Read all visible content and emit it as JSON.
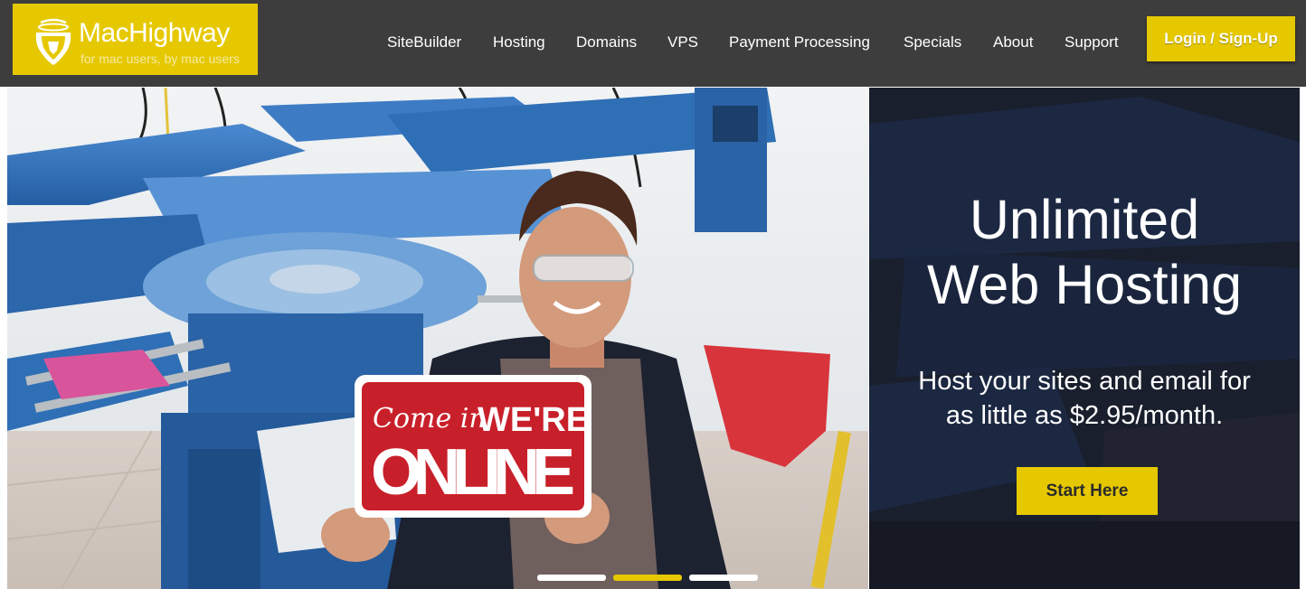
{
  "header": {
    "logo": {
      "name": "MacHighway",
      "tagline": "for mac users, by mac users"
    },
    "nav": [
      {
        "label": "SiteBuilder"
      },
      {
        "label": "Hosting"
      },
      {
        "label": "Domains"
      },
      {
        "label": "VPS"
      },
      {
        "label": "Payment Processing"
      },
      {
        "label": "Specials"
      },
      {
        "label": "About"
      },
      {
        "label": "Support"
      }
    ],
    "login_label": "Login / Sign-Up"
  },
  "hero": {
    "sign": {
      "script": "Come in",
      "line1": "WE'RE",
      "line2": "ONLINE"
    },
    "headline_line1": "Unlimited",
    "headline_line2": "Web Hosting",
    "subline_line1": "Host your sites and email for",
    "subline_line2": "as little as $2.95/month.",
    "cta_label": "Start Here",
    "carousel": {
      "slides": 3,
      "active_index": 1
    }
  },
  "colors": {
    "accent": "#e6c800",
    "header_bg": "#3d3d3d",
    "sign_red": "#c8202a",
    "press_blue": "#2f6fb5"
  },
  "icons": {
    "logo_mark": "mac-helmet-icon"
  }
}
